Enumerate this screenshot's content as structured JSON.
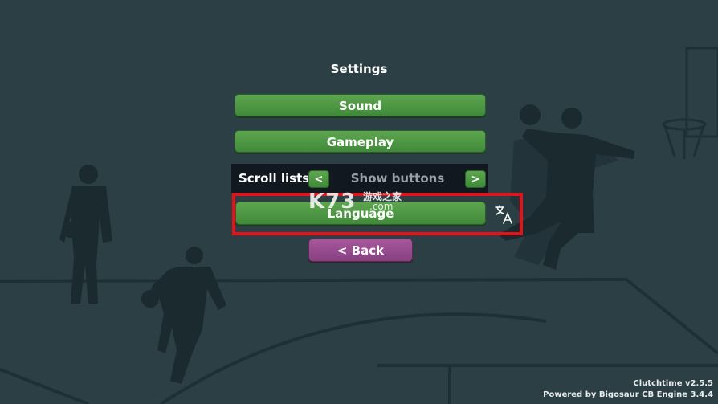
{
  "title": "Settings",
  "buttons": {
    "sound": "Sound",
    "gameplay": "Gameplay",
    "language": "Language",
    "back": "< Back"
  },
  "scroll_lists": {
    "label": "Scroll lists",
    "prev": "<",
    "value": "Show buttons",
    "next": ">"
  },
  "watermark": {
    "logo": "K73",
    "site_cn": "游戏之家",
    "domain": ".com"
  },
  "footer": {
    "version": "Clutchtime v2.5.5",
    "engine": "Powered by Bigosaur CB Engine 3.4.4"
  },
  "colors": {
    "background": "#2b3f45",
    "button_green": "#4f9a45",
    "button_purple": "#974a8d",
    "highlight_red": "#e0141a"
  },
  "icons": [
    "translate-icon"
  ]
}
